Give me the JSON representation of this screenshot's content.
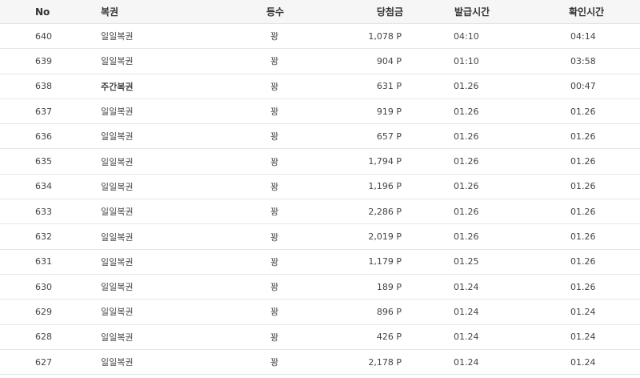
{
  "header": {
    "no": "No",
    "lottery": "복권",
    "rank": "등수",
    "prize": "당첨금",
    "issued": "발급시간",
    "checked": "확인시간"
  },
  "rows": [
    {
      "no": "640",
      "lottery": "일일복권",
      "rank": "꽝",
      "prize": "1,078 P",
      "issued": "04:10",
      "checked": "04:14",
      "bold": false
    },
    {
      "no": "639",
      "lottery": "일일복권",
      "rank": "꽝",
      "prize": "904 P",
      "issued": "01:10",
      "checked": "03:58",
      "bold": false
    },
    {
      "no": "638",
      "lottery": "주간복권",
      "rank": "꽝",
      "prize": "631 P",
      "issued": "01.26",
      "checked": "00:47",
      "bold": true
    },
    {
      "no": "637",
      "lottery": "일일복권",
      "rank": "꽝",
      "prize": "919 P",
      "issued": "01.26",
      "checked": "01.26",
      "bold": false
    },
    {
      "no": "636",
      "lottery": "일일복권",
      "rank": "꽝",
      "prize": "657 P",
      "issued": "01.26",
      "checked": "01.26",
      "bold": false
    },
    {
      "no": "635",
      "lottery": "일일복권",
      "rank": "꽝",
      "prize": "1,794 P",
      "issued": "01.26",
      "checked": "01.26",
      "bold": false
    },
    {
      "no": "634",
      "lottery": "일일복권",
      "rank": "꽝",
      "prize": "1,196 P",
      "issued": "01.26",
      "checked": "01.26",
      "bold": false
    },
    {
      "no": "633",
      "lottery": "일일복권",
      "rank": "꽝",
      "prize": "2,286 P",
      "issued": "01.26",
      "checked": "01.26",
      "bold": false
    },
    {
      "no": "632",
      "lottery": "일일복권",
      "rank": "꽝",
      "prize": "2,019 P",
      "issued": "01.26",
      "checked": "01.26",
      "bold": false
    },
    {
      "no": "631",
      "lottery": "일일복권",
      "rank": "꽝",
      "prize": "1,179 P",
      "issued": "01.25",
      "checked": "01.26",
      "bold": false
    },
    {
      "no": "630",
      "lottery": "일일복권",
      "rank": "꽝",
      "prize": "189 P",
      "issued": "01.24",
      "checked": "01.26",
      "bold": false
    },
    {
      "no": "629",
      "lottery": "일일복권",
      "rank": "꽝",
      "prize": "896 P",
      "issued": "01.24",
      "checked": "01.24",
      "bold": false
    },
    {
      "no": "628",
      "lottery": "일일복권",
      "rank": "꽝",
      "prize": "426 P",
      "issued": "01.24",
      "checked": "01.24",
      "bold": false
    },
    {
      "no": "627",
      "lottery": "일일복권",
      "rank": "꽝",
      "prize": "2,178 P",
      "issued": "01.24",
      "checked": "01.24",
      "bold": false
    }
  ]
}
